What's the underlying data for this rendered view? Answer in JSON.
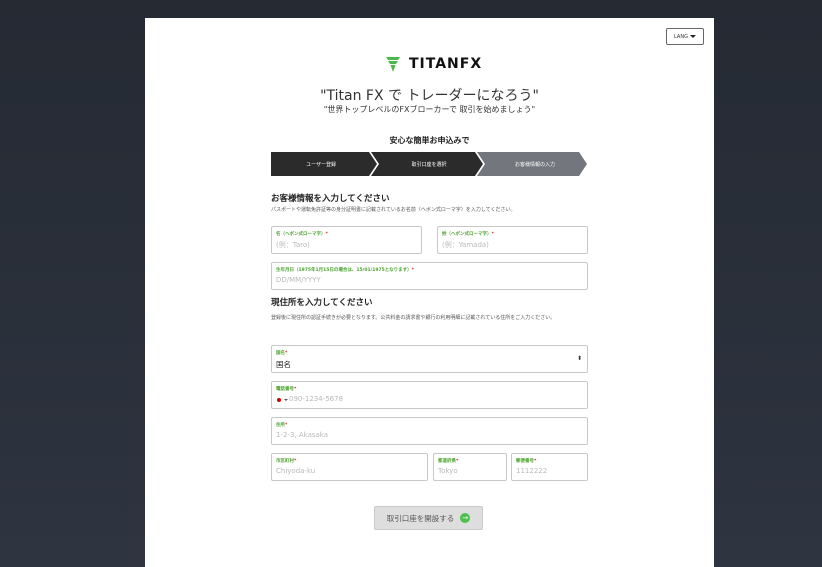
{
  "lang_button": {
    "label": "LANG"
  },
  "brand": {
    "name": "TITANFX",
    "color": "#4cb84c"
  },
  "hero": {
    "title": "\"Titan FX で トレーダーになろう\"",
    "subtitle": "\"世界トップレベルのFXブローカーで 取引を始めましょう\""
  },
  "steps": {
    "heading": "安心な簡単お申込みで",
    "items": [
      {
        "label": "ユーザー登録",
        "state": "done"
      },
      {
        "label": "取引口座を選択",
        "state": "done"
      },
      {
        "label": "お客様情報の入力",
        "state": "active"
      }
    ]
  },
  "customer_section": {
    "heading": "お客様情報を入力してください",
    "description": "パスポートや運転免許証等の身分証明書に記載されているお名前（ヘボン式ローマ字）を入力してください。",
    "first_name": {
      "label": "名（ヘボン式ローマ字）",
      "placeholder": "(例：Taro)"
    },
    "last_name": {
      "label": "姓（ヘボン式ローマ字）",
      "placeholder": "(例：Yamada)"
    },
    "dob": {
      "label": "生年月日（1975年1月15日の場合は、15/01/1975となります）",
      "placeholder": "DD/MM/YYYY"
    }
  },
  "address_section": {
    "heading": "現住所を入力してください",
    "description": "登録後に現住所の認証手続きが必要となります。公共料金の請求書や銀行の利用明細に記載されている住所をご入力ください。",
    "country": {
      "label": "国名",
      "value": "国名"
    },
    "phone": {
      "label": "電話番号",
      "placeholder": "090-1234-5678"
    },
    "address": {
      "label": "住所",
      "placeholder": "1-2-3, Akasaka"
    },
    "city": {
      "label": "市区町村",
      "placeholder": "Chiyoda-ku"
    },
    "prefecture": {
      "label": "都道府県",
      "placeholder": "Tokyo"
    },
    "postal": {
      "label": "郵便番号",
      "placeholder": "1112222"
    }
  },
  "submit": {
    "label": "取引口座を開設する"
  },
  "required_mark": "*"
}
